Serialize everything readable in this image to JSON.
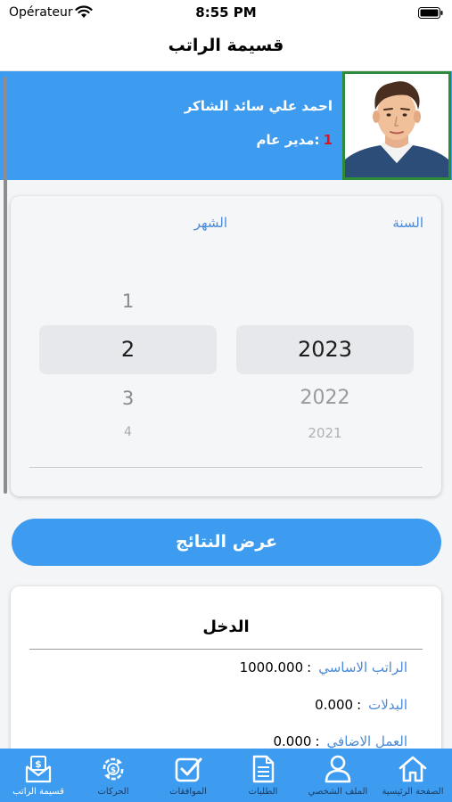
{
  "status_bar": {
    "carrier": "Opérateur",
    "time": "8:55 PM"
  },
  "nav": {
    "title": "قسيمة الراتب"
  },
  "employee": {
    "name": "احمد علي سائد الشاكر",
    "role_number": "1",
    "role": ":مدير عام"
  },
  "picker": {
    "year_label": "السنة",
    "month_label": "الشهر",
    "year_selected": "2023",
    "year_below_1": "2022",
    "year_below_2": "2021",
    "month_above": "1",
    "month_selected": "2",
    "month_below_1": "3",
    "month_below_2": "4"
  },
  "show_button": {
    "label": "عرض النتائج"
  },
  "income": {
    "title": "الدخل",
    "rows": [
      {
        "label": "الراتب الاساسي",
        "value": "1000.000"
      },
      {
        "label": "البدلات",
        "value": "0.000"
      },
      {
        "label": "العمل الاضافي",
        "value": "0.000"
      }
    ]
  },
  "tabs": [
    {
      "label": "قسيمة الراتب",
      "icon": "payslip-icon"
    },
    {
      "label": "الحركات",
      "icon": "transactions-icon"
    },
    {
      "label": "الموافقات",
      "icon": "approvals-icon"
    },
    {
      "label": "الطلبات",
      "icon": "requests-icon"
    },
    {
      "label": "الملف الشخصي",
      "icon": "profile-icon"
    },
    {
      "label": "الصفحة الرئيسية",
      "icon": "home-icon"
    }
  ],
  "colors": {
    "accent": "#3d9cf0",
    "avatar_border": "#2e8b3a",
    "role_number": "#e0141e",
    "label_blue": "#4a8ad8"
  }
}
